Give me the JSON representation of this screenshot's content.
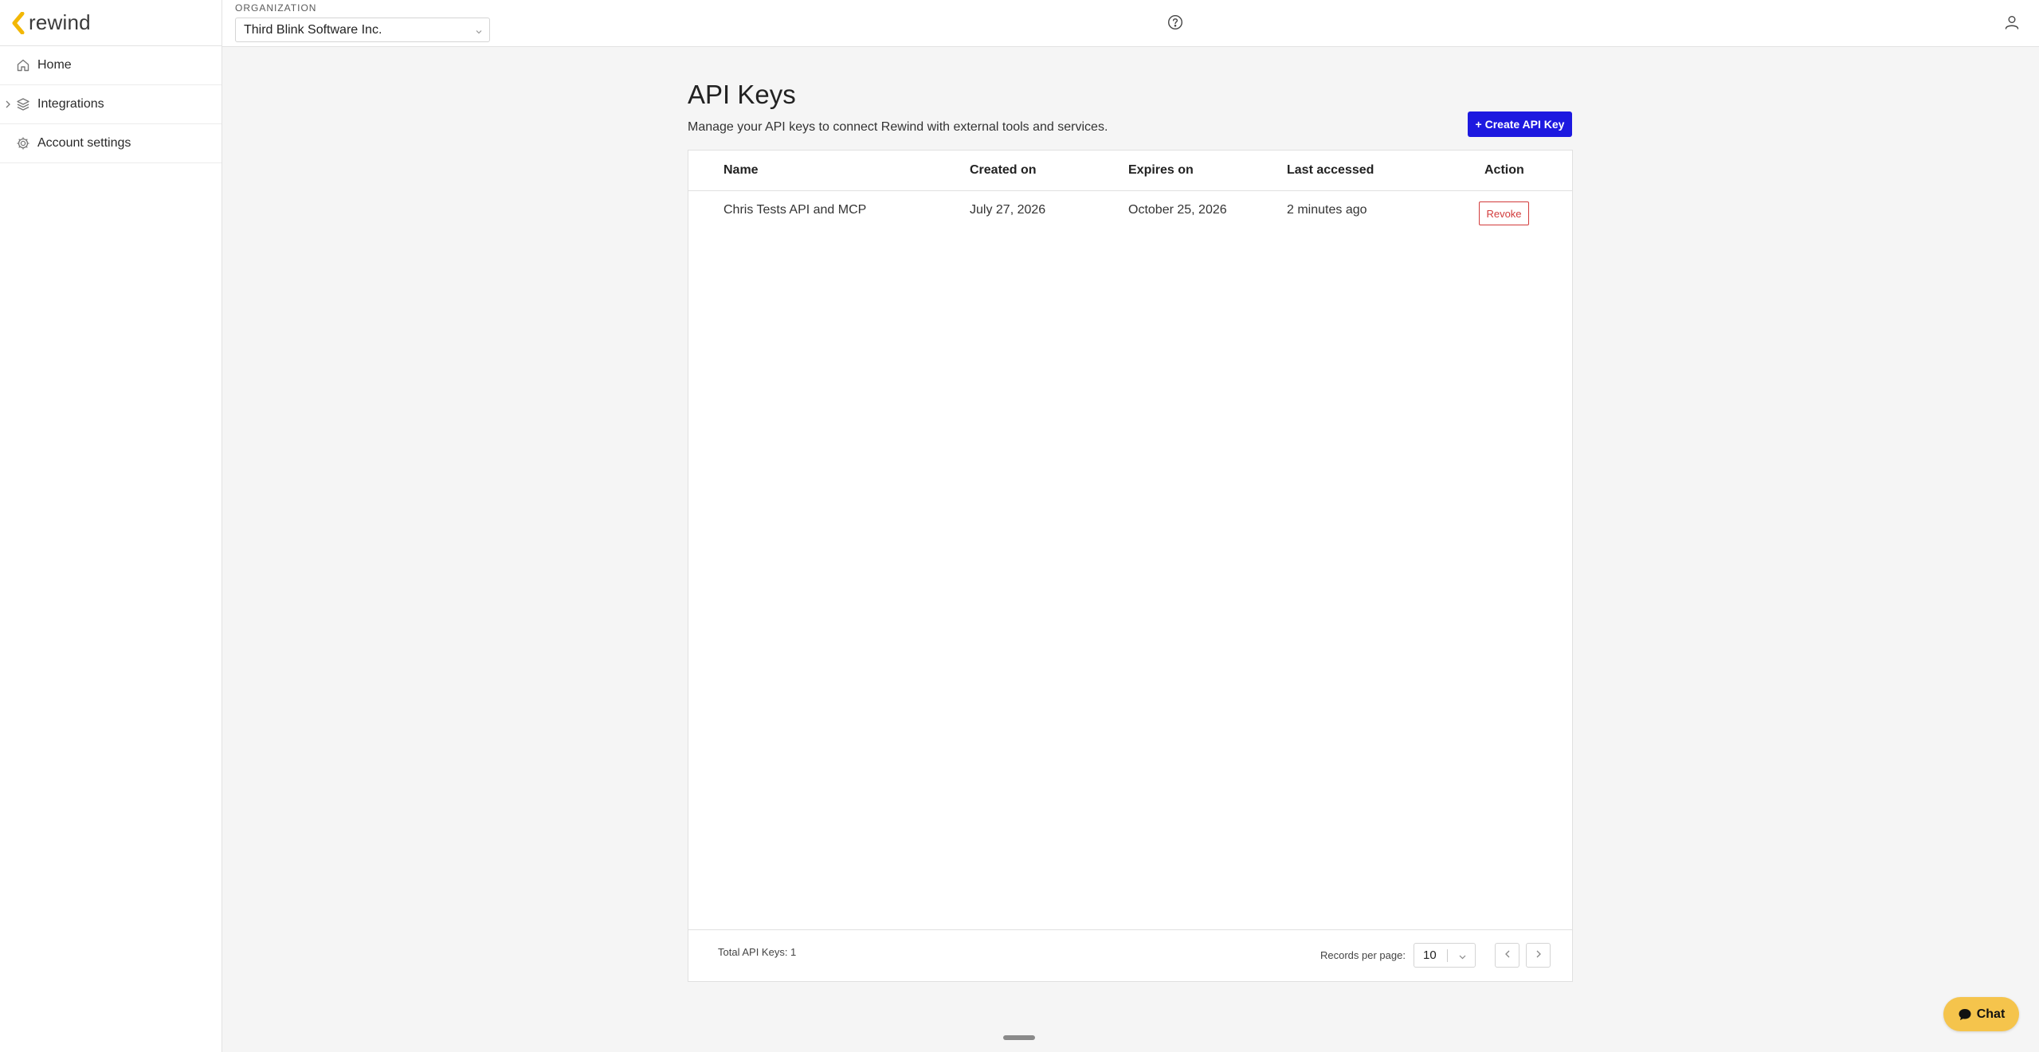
{
  "brand": {
    "name": "rewind",
    "accent": "#f2b705"
  },
  "sidebar": {
    "items": [
      {
        "label": "Home",
        "icon": "home-icon"
      },
      {
        "label": "Integrations",
        "icon": "layers-icon",
        "expandable": true
      },
      {
        "label": "Account settings",
        "icon": "gear-icon"
      }
    ]
  },
  "topbar": {
    "org_label": "ORGANIZATION",
    "org_value": "Third Blink Software Inc."
  },
  "page": {
    "title": "API Keys",
    "description": "Manage your API keys to connect Rewind with external tools and services.",
    "create_label": "+ Create API Key"
  },
  "table": {
    "columns": [
      "Name",
      "Created on",
      "Expires on",
      "Last accessed",
      "Action"
    ],
    "rows": [
      {
        "name": "Chris Tests API and MCP",
        "created": "July 27, 2026",
        "expires": "October 25, 2026",
        "last_accessed": "2 minutes ago",
        "action": "Revoke"
      }
    ],
    "total": "Total API Keys: 1",
    "records_label": "Records per page:",
    "records_value": "10"
  },
  "chat": {
    "label": "Chat"
  },
  "colors": {
    "primary": "#1d19e0",
    "danger": "#d23b3b",
    "chat": "#f5c44c"
  }
}
